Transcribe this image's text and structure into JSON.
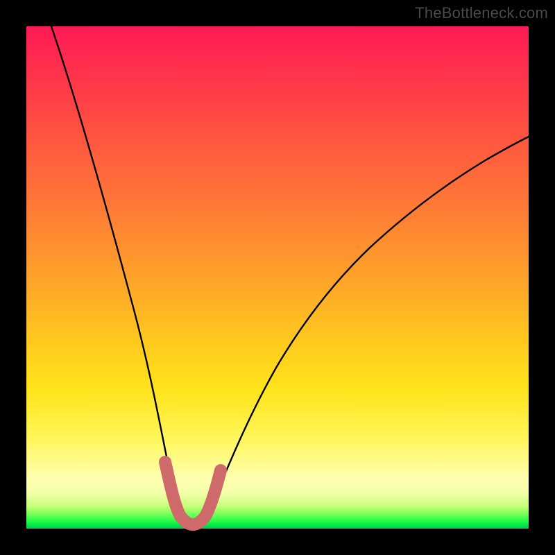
{
  "watermark": "TheBottleneck.com",
  "chart_data": {
    "type": "line",
    "title": "",
    "xlabel": "",
    "ylabel": "",
    "xlim": [
      0,
      100
    ],
    "ylim": [
      0,
      100
    ],
    "grid": false,
    "series": [
      {
        "name": "bottleneck-curve",
        "color": "#000000",
        "x": [
          5,
          8,
          11,
          14,
          17,
          20,
          23,
          25,
          27,
          28.5,
          30,
          31.5,
          33,
          35,
          38,
          42,
          46,
          50,
          55,
          60,
          66,
          73,
          80,
          88,
          96,
          100
        ],
        "y": [
          100,
          90,
          80,
          70,
          60,
          50,
          40,
          30,
          20,
          12,
          6,
          3,
          3,
          6,
          14,
          26,
          36,
          44,
          51,
          57,
          62,
          67,
          71,
          74.5,
          77.5,
          79
        ]
      },
      {
        "name": "highlight-region",
        "color": "#cf6a6a",
        "x": [
          25.5,
          27,
          28.5,
          30,
          31.5,
          33,
          34.5
        ],
        "y": [
          13,
          8,
          4.5,
          3,
          3,
          4.5,
          9
        ]
      }
    ],
    "annotations": []
  }
}
